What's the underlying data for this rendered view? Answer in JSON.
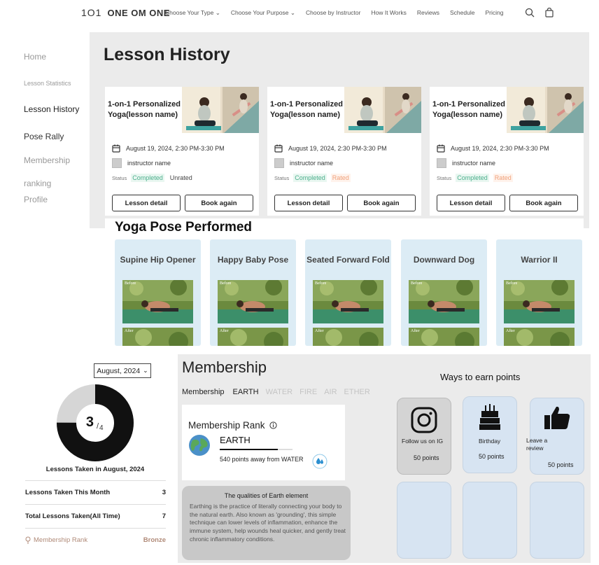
{
  "nav": {
    "logo_mark": "1O1",
    "logo_text": "ONE OM ONE",
    "links": [
      "Choose Your Type",
      "Choose Your Purpose",
      "Choose by Instructor",
      "How It Works",
      "Reviews",
      "Schedule",
      "Pricing"
    ],
    "icons": [
      "search-icon",
      "cart-icon"
    ]
  },
  "sidebar": {
    "items": [
      "Home",
      "Lesson Statistics",
      "Lesson History",
      "Pose Rally",
      "Membership",
      "ranking",
      "Profile"
    ]
  },
  "lesson_history": {
    "title": "Lesson History",
    "cards": [
      {
        "name": "1-on-1 Personalized Yoga(lesson name)",
        "datetime": "August 19, 2024, 2:30 PM-3:30 PM",
        "instructor": "instructor name",
        "status_label": "Status",
        "status": "Completed",
        "rating": "Unrated",
        "rating_style": "unrated",
        "detail_btn": "Lesson detail",
        "again_btn": "Book again"
      },
      {
        "name": "1-on-1 Personalized Yoga(lesson name)",
        "datetime": "August 19, 2024, 2:30 PM-3:30 PM",
        "instructor": "instructor name",
        "status_label": "Status",
        "status": "Completed",
        "rating": "Rated",
        "rating_style": "rated",
        "detail_btn": "Lesson detail",
        "again_btn": "Book again"
      },
      {
        "name": "1-on-1 Personalized Yoga(lesson name)",
        "datetime": "August 19, 2024, 2:30 PM-3:30 PM",
        "instructor": "instructor name",
        "status_label": "Status",
        "status": "Completed",
        "rating": "Rated",
        "rating_style": "rated",
        "detail_btn": "Lesson detail",
        "again_btn": "Book again"
      }
    ]
  },
  "yoga_poses": {
    "title": "Yoga Pose Performed",
    "before_label": "Before",
    "after_label": "After",
    "poses": [
      "Supine Hip Opener",
      "Happy Baby Pose",
      "Seated Forward Fold",
      "Downward Dog",
      "Warrior II"
    ]
  },
  "stats": {
    "month": "August, 2024",
    "taken": "3",
    "total": "4",
    "taken_fraction": 0.75,
    "donut_caption": "Lessons Taken in August, 2024",
    "rows": [
      {
        "label": "Lessons Taken This Month",
        "value": "3"
      },
      {
        "label": "Total Lessons Taken(All Time)",
        "value": "7"
      }
    ],
    "rank_label": "Membership Rank",
    "rank_value": "Bronze"
  },
  "membership": {
    "title": "Membership",
    "tabs": [
      "Membership",
      "EARTH",
      "WATER",
      "FIRE",
      "AIR",
      "ETHER"
    ],
    "rank_title": "Membership Rank",
    "rank_level": "EARTH",
    "progress": 0.8,
    "points_away": "540 points away from WATER",
    "earth_title": "The qualities of Earth element",
    "earth_text": "Earthing is the practice of literally connecting your body to the natural earth. Also known as 'grounding', this simple technique can lower levels of inflammation, enhance the immune system, help wounds heal quicker, and gently treat chronic inflammatory conditions.",
    "ways_title": "Ways to earn points",
    "ways": [
      {
        "label": "Follow us on IG",
        "points": "50 points",
        "icon": "instagram-icon"
      },
      {
        "label": "Birthday",
        "points": "50 points",
        "icon": "birthday-cake-icon"
      },
      {
        "label": "Leave a review",
        "points": "50 points",
        "icon": "thumbs-up-icon"
      }
    ],
    "colors": {
      "earn_gray": "#d4d4d4",
      "earn_blue": "#d7e4f2"
    }
  },
  "colors": {
    "completed": "#4caf8c",
    "rated": "#f0a07a",
    "rank_bronze": "#b08a78"
  }
}
